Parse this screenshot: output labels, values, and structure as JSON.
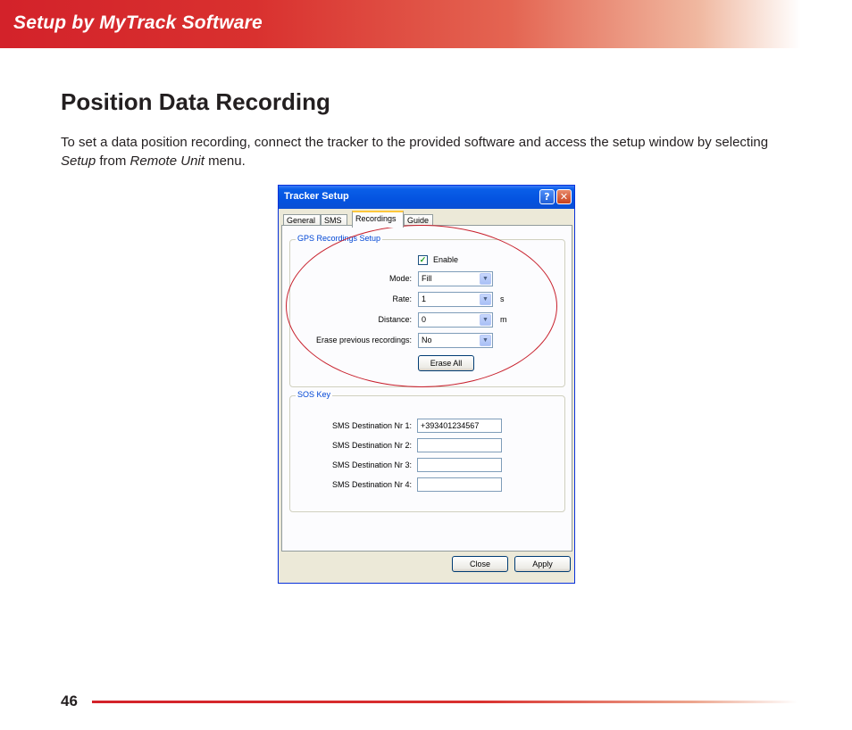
{
  "header": {
    "title": "Setup by MyTrack Software"
  },
  "page": {
    "title": "Position Data Recording",
    "intro_before": "To set a data position recording, connect the tracker to the provided software and access the setup window by selecting ",
    "intro_em1": "Setup",
    "intro_mid": " from ",
    "intro_em2": "Remote Unit",
    "intro_after": " menu.",
    "page_number": "46"
  },
  "dialog": {
    "title": "Tracker Setup",
    "help_glyph": "?",
    "close_glyph": "✕",
    "tabs": [
      "General",
      "SMS",
      "Recordings",
      "Guide"
    ],
    "active_tab": "Recordings",
    "gps_group": {
      "title": "GPS Recordings Setup",
      "enable_label": "Enable",
      "enable_checked": true,
      "mode_label": "Mode:",
      "mode_value": "Fill",
      "rate_label": "Rate:",
      "rate_value": "1",
      "rate_unit": "s",
      "distance_label": "Distance:",
      "distance_value": "0",
      "distance_unit": "m",
      "erase_label": "Erase previous recordings:",
      "erase_value": "No",
      "erase_all_button": "Erase All"
    },
    "sos_group": {
      "title": "SOS Key",
      "fields": [
        {
          "label": "SMS Destination Nr 1:",
          "value": "+393401234567"
        },
        {
          "label": "SMS Destination Nr 2:",
          "value": ""
        },
        {
          "label": "SMS Destination Nr 3:",
          "value": ""
        },
        {
          "label": "SMS Destination Nr 4:",
          "value": ""
        }
      ]
    },
    "close_button": "Close",
    "apply_button": "Apply"
  },
  "colors": {
    "brand_red": "#d3222a",
    "highlight_ellipse": "#c8202c",
    "xp_titlebar": "#0453e0"
  },
  "icons": {
    "combo_arrow": "chevron-down-icon",
    "check": "checkmark-icon"
  }
}
